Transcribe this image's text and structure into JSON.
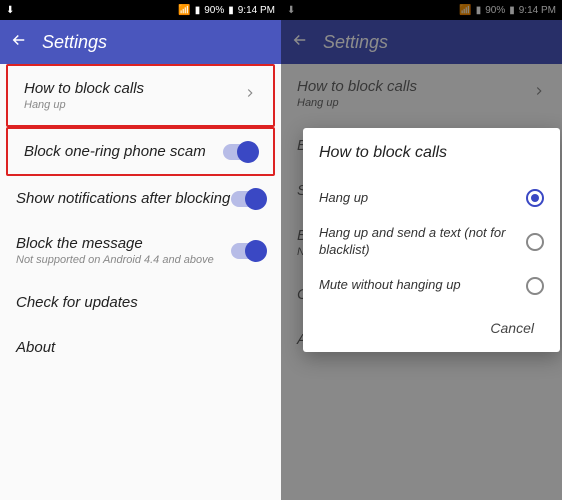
{
  "statusbar": {
    "battery": "90%",
    "time": "9:14 PM"
  },
  "appbar": {
    "title": "Settings"
  },
  "settings": {
    "items": [
      {
        "label": "How to block calls",
        "sub": "Hang up",
        "type": "chevron"
      },
      {
        "label": "Block one-ring phone scam",
        "type": "toggle",
        "on": true
      },
      {
        "label": "Show notifications after blocking",
        "type": "toggle",
        "on": true
      },
      {
        "label": "Block the message",
        "sub": "Not supported on Android 4.4 and above",
        "type": "toggle",
        "on": true
      },
      {
        "label": "Check for updates",
        "type": "none"
      },
      {
        "label": "About",
        "type": "none"
      }
    ]
  },
  "dialog": {
    "title": "How to block calls",
    "options": [
      {
        "label": "Hang up",
        "selected": true
      },
      {
        "label": "Hang up and send a text (not for blacklist)",
        "selected": false
      },
      {
        "label": "Mute without hanging up",
        "selected": false
      }
    ],
    "cancel": "Cancel"
  }
}
